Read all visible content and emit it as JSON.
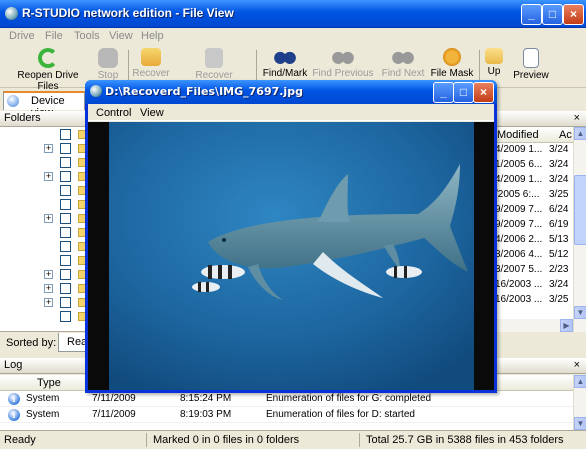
{
  "app": {
    "title": "R-STUDIO network edition - File View"
  },
  "window_buttons": {
    "min": "_",
    "max": "□",
    "close": "×"
  },
  "menu": [
    "Drive",
    "File",
    "Tools",
    "View",
    "Help"
  ],
  "toolbar": [
    {
      "label": "Reopen Drive Files",
      "enabled": true,
      "icon": "refresh-icon"
    },
    {
      "label": "Stop",
      "enabled": false,
      "icon": "stop-icon"
    },
    {
      "label": "Recover",
      "enabled": false,
      "icon": "recover-icon"
    },
    {
      "label": "Recover Marked",
      "enabled": false,
      "icon": "recover-marked-icon"
    },
    {
      "label": "Find/Mark",
      "enabled": true,
      "icon": "binoculars-icon"
    },
    {
      "label": "Find Previous",
      "enabled": false,
      "icon": "find-previous-icon"
    },
    {
      "label": "Find Next",
      "enabled": false,
      "icon": "find-next-icon"
    },
    {
      "label": "File Mask",
      "enabled": true,
      "icon": "file-mask-icon"
    },
    {
      "label": "Up",
      "enabled": true,
      "icon": "folder-up-icon"
    },
    {
      "label": "Preview",
      "enabled": true,
      "icon": "preview-icon"
    }
  ],
  "tabs": {
    "device_view": "Device view"
  },
  "folders": {
    "header": "Folders",
    "close": "×",
    "sorted_by_label": "Sorted by:",
    "sorted_tab": "Real"
  },
  "file_grid": {
    "headers": [
      "Modified",
      "Ac"
    ],
    "rows": [
      [
        "4/2009 1...",
        "3/24"
      ],
      [
        "1/2005 6...",
        "3/24"
      ],
      [
        "4/2009 1...",
        "3/24"
      ],
      [
        "/2005 6:...",
        "3/25"
      ],
      [
        "9/2009 7...",
        "6/24"
      ],
      [
        "9/2009 7...",
        "6/19"
      ],
      [
        "4/2006 2...",
        "5/13"
      ],
      [
        "3/2006 4...",
        "5/12"
      ],
      [
        "3/2007 5...",
        "2/23"
      ],
      [
        "16/2003 ...",
        "3/24"
      ],
      [
        "16/2003 ...",
        "3/25"
      ]
    ]
  },
  "log": {
    "header": "Log",
    "close": "×",
    "columns": [
      "Type"
    ],
    "rows": [
      {
        "type": "System",
        "date": "7/11/2009",
        "time": "8:15:24 PM",
        "text": "Enumeration of files for G: completed"
      },
      {
        "type": "System",
        "date": "7/11/2009",
        "time": "8:19:03 PM",
        "text": "Enumeration of files for D: started"
      }
    ]
  },
  "status": {
    "ready": "Ready",
    "marked": "Marked 0 in 0 files in 0 folders",
    "total": "Total 25.7 GB in 5388 files in 453 folders"
  },
  "viewer": {
    "title": "D:\\Recoverd_Files\\IMG_7697.jpg",
    "menu": [
      "Control",
      "View"
    ]
  },
  "colors": {
    "xp_blue": "#0054e3",
    "water": "#1f6fa8"
  }
}
